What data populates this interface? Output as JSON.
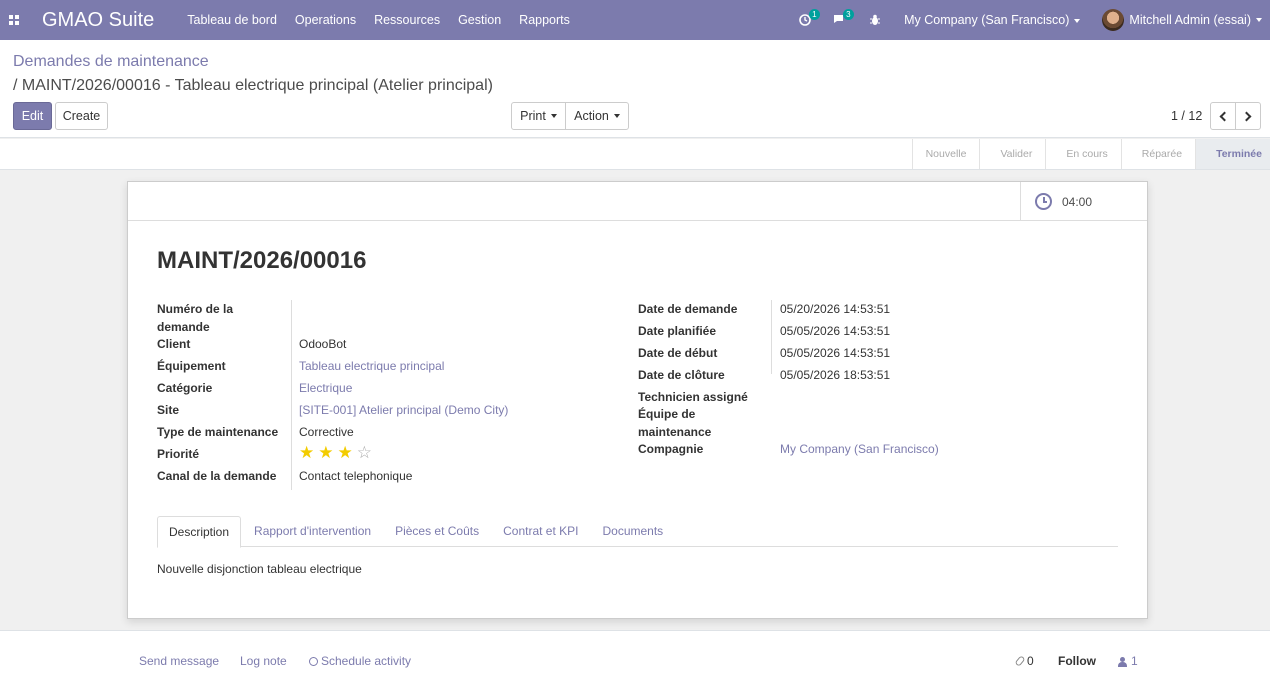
{
  "navbar": {
    "brand": "GMAO Suite",
    "menu": [
      "Tableau de bord",
      "Operations",
      "Ressources",
      "Gestion",
      "Rapports"
    ],
    "activity_count": "1",
    "messages_count": "3",
    "company": "My Company (San Francisco)",
    "user": "Mitchell Admin (essai)"
  },
  "breadcrumb": {
    "parent": "Demandes de maintenance",
    "current": "/ MAINT/2026/00016 - Tableau electrique principal (Atelier principal)"
  },
  "toolbar": {
    "edit": "Edit",
    "create": "Create",
    "print": "Print",
    "action": "Action",
    "pager": "1 / 12"
  },
  "stages": [
    "Nouvelle",
    "Valider",
    "En cours",
    "Réparée",
    "Terminée"
  ],
  "active_stage": "Terminée",
  "stat": {
    "value": "04:00"
  },
  "record": {
    "title": "MAINT/2026/00016",
    "left": [
      {
        "label": "Numéro de la demande",
        "value": ""
      },
      {
        "label": "Client",
        "value": "OdooBot"
      },
      {
        "label": "Équipement",
        "value": "Tableau electrique principal"
      },
      {
        "label": "Catégorie",
        "value": "Electrique"
      },
      {
        "label": "Site",
        "value": "[SITE-001] Atelier principal (Demo City)"
      },
      {
        "label": "Type de maintenance",
        "value": "Corrective"
      },
      {
        "label": "Priorité",
        "value": ""
      },
      {
        "label": "Canal de la demande",
        "value": "Contact telephonique"
      }
    ],
    "priority": {
      "filled": 3,
      "total": 4
    },
    "right": [
      {
        "label": "Date de demande",
        "value": "05/20/2026 14:53:51"
      },
      {
        "label": "Date planifiée",
        "value": "05/05/2026 14:53:51"
      },
      {
        "label": "Date de début",
        "value": "05/05/2026 14:53:51"
      },
      {
        "label": "Date de clôture",
        "value": "05/05/2026 18:53:51"
      },
      {
        "label": "Technicien assigné",
        "value": ""
      },
      {
        "label": "Équipe de maintenance",
        "value": ""
      },
      {
        "label": "Compagnie",
        "value": "My Company (San Francisco)"
      }
    ]
  },
  "tabs": [
    "Description",
    "Rapport d'intervention",
    "Pièces et Coûts",
    "Contrat et KPI",
    "Documents"
  ],
  "description": "Nouvelle disjonction tableau electrique",
  "chatter": {
    "send_message": "Send message",
    "log_note": "Log note",
    "schedule_activity": "Schedule activity",
    "attachments": "0",
    "follow": "Follow",
    "followers": "1"
  }
}
